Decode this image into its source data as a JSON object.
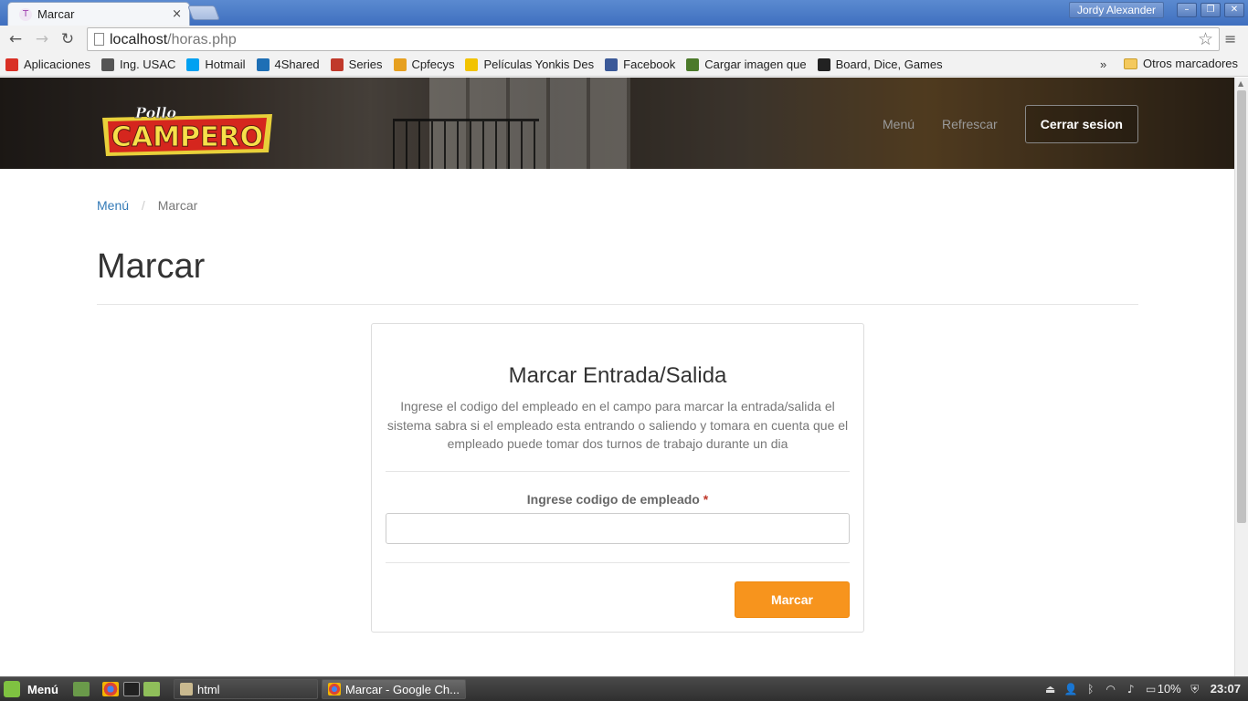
{
  "browser": {
    "tab_title": "Marcar",
    "tab_close": "×",
    "user_name": "Jordy Alexander",
    "url_host": "localhost",
    "url_path": "/horas.php"
  },
  "bookmarks": {
    "items": [
      {
        "label": "Aplicaciones",
        "icon": "apps-grid-icon",
        "color": "#d93025"
      },
      {
        "label": "Ing. USAC",
        "icon": "usac-icon",
        "color": "#555555"
      },
      {
        "label": "Hotmail",
        "icon": "windows-icon",
        "color": "#00a1f1"
      },
      {
        "label": "4Shared",
        "icon": "4shared-icon",
        "color": "#1e6fb5"
      },
      {
        "label": "Series",
        "icon": "series-icon",
        "color": "#c0392b"
      },
      {
        "label": "Cpfecys",
        "icon": "cpfecys-icon",
        "color": "#e6a020"
      },
      {
        "label": "Películas Yonkis Des",
        "icon": "yonkis-icon",
        "color": "#f2c300"
      },
      {
        "label": "Facebook",
        "icon": "facebook-icon",
        "color": "#3b5998"
      },
      {
        "label": "Cargar imagen que",
        "icon": "image-upload-icon",
        "color": "#4c7a2a"
      },
      {
        "label": "Board, Dice, Games",
        "icon": "board-games-icon",
        "color": "#222222"
      }
    ],
    "more": "»",
    "other": "Otros marcadores"
  },
  "site": {
    "logo_top": "Pollo",
    "logo_main": "CAMPERO",
    "nav": {
      "menu": "Menú",
      "refresh": "Refrescar",
      "logout": "Cerrar sesion"
    },
    "breadcrumb": {
      "home": "Menú",
      "separator": "/",
      "current": "Marcar"
    },
    "page_title": "Marcar",
    "card": {
      "title": "Marcar Entrada/Salida",
      "description": "Ingrese el codigo del empleado en el campo para marcar la entrada/salida el sistema sabra si el empleado esta entrando o saliendo y tomara en cuenta que el empleado puede tomar dos turnos de trabajo durante un dia",
      "field_label": "Ingrese codigo de empleado",
      "required_mark": "*",
      "input_value": "",
      "submit": "Marcar"
    },
    "colors": {
      "accent": "#f7941d",
      "link": "#337ab7"
    }
  },
  "taskbar": {
    "start_label": "Menú",
    "tasks": [
      {
        "label": "html",
        "icon": "folder-icon"
      },
      {
        "label": "Marcar - Google Ch...",
        "icon": "chrome-icon"
      }
    ],
    "battery": "10%",
    "clock": "23:07"
  }
}
